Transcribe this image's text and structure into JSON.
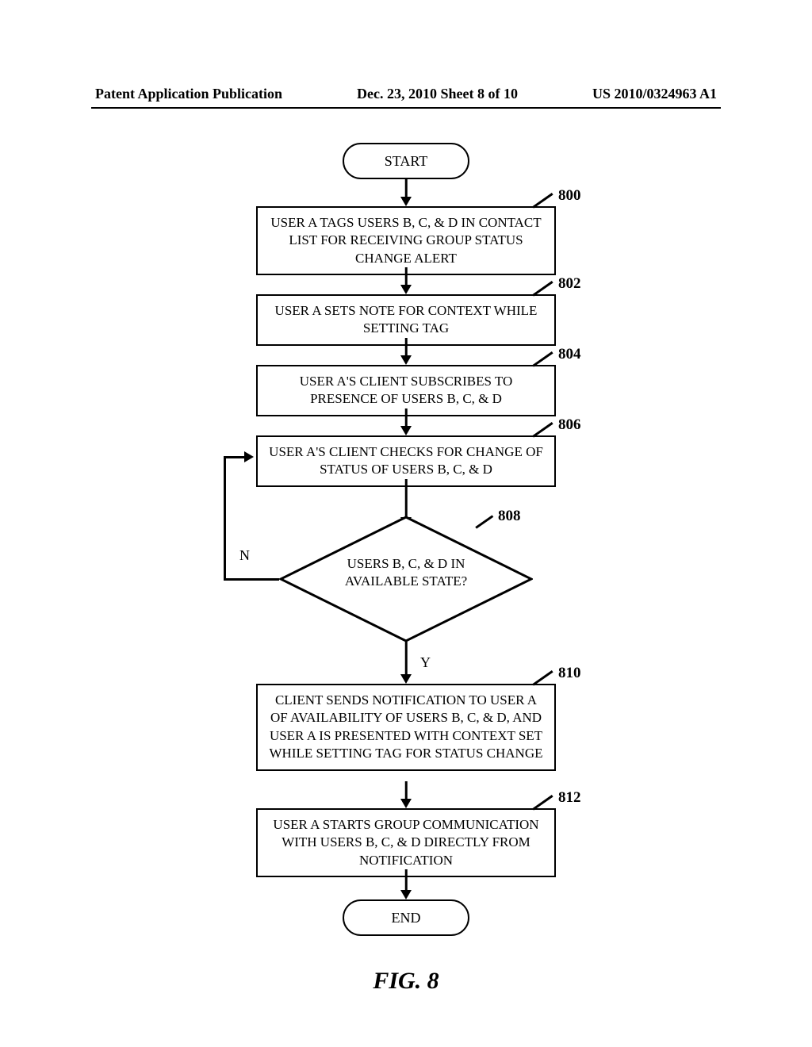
{
  "header": {
    "left": "Patent Application Publication",
    "center": "Dec. 23, 2010  Sheet 8 of 10",
    "right": "US 2010/0324963 A1"
  },
  "flow": {
    "start": "START",
    "end": "END",
    "s800": "USER A TAGS USERS B, C, & D IN CONTACT LIST FOR RECEIVING GROUP STATUS CHANGE ALERT",
    "s802": "USER A SETS NOTE FOR CONTEXT WHILE SETTING TAG",
    "s804": "USER A'S CLIENT SUBSCRIBES TO PRESENCE OF USERS B, C, & D",
    "s806": "USER A'S CLIENT CHECKS FOR CHANGE OF STATUS OF USERS B, C, & D",
    "s808": "USERS B, C, & D  IN AVAILABLE STATE?",
    "s810": "CLIENT SENDS NOTIFICATION TO USER A OF AVAILABILITY OF USERS B, C, & D, AND USER A IS PRESENTED WITH CONTEXT SET WHILE SETTING TAG FOR STATUS CHANGE",
    "s812": "USER A STARTS GROUP COMMUNICATION WITH USERS B, C, & D DIRECTLY FROM NOTIFICATION"
  },
  "labels": {
    "r800": "800",
    "r802": "802",
    "r804": "804",
    "r806": "806",
    "r808": "808",
    "r810": "810",
    "r812": "812",
    "no": "N",
    "yes": "Y"
  },
  "caption": "FIG. 8"
}
